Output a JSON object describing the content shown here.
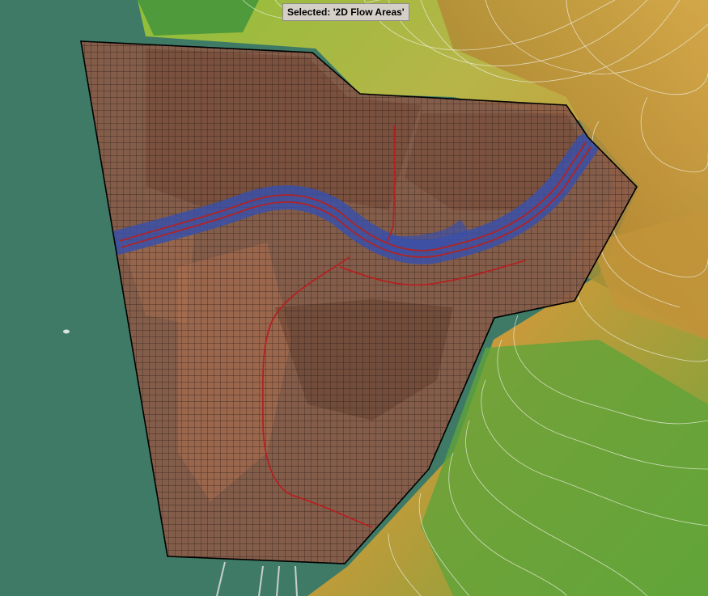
{
  "status": {
    "selected_label": "Selected: '2D Flow Areas'"
  },
  "layers": {
    "terrain": "terrain-hillshade",
    "contours": "elevation-contours",
    "flow_area": "2D Flow Areas",
    "mesh": "computational-mesh",
    "breaklines": "channel-breaklines",
    "water": "ocean"
  },
  "colors": {
    "ocean": "#3e7a66",
    "flow_area_fill": "#8a5a48",
    "mesh_line": "#1f1410",
    "channel_blue": "#3a50a8",
    "breakline_red": "#b22222",
    "terrain_green": "#6aa63a",
    "terrain_yellow": "#c9a63a"
  }
}
